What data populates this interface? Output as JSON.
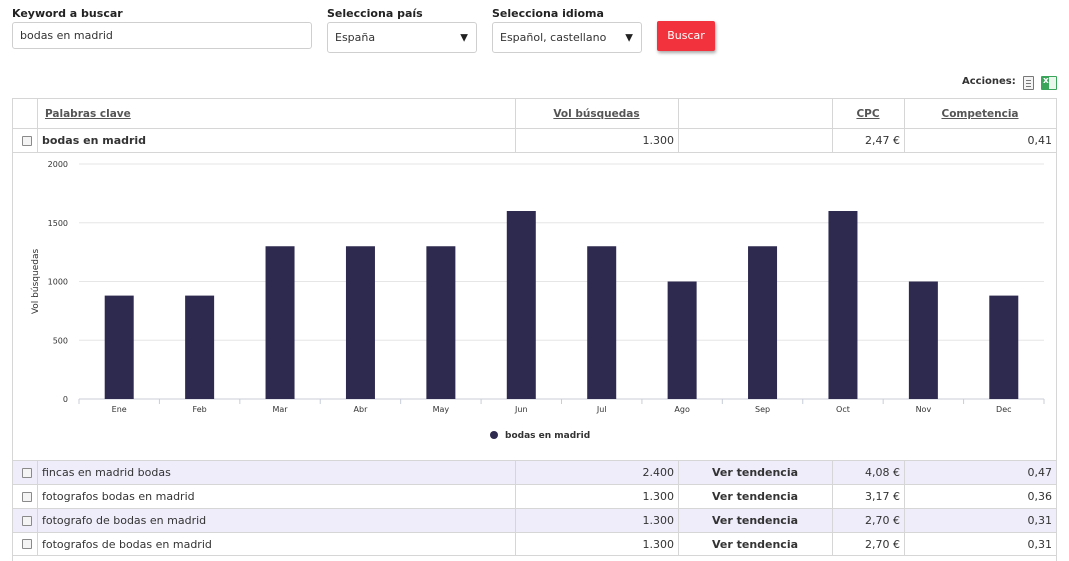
{
  "form": {
    "keyword_label": "Keyword a buscar",
    "keyword_value": "bodas en madrid",
    "country_label": "Selecciona país",
    "country_value": "España",
    "language_label": "Selecciona idioma",
    "language_value": "Español, castellano",
    "search_button": "Buscar"
  },
  "actions": {
    "label": "Acciones:",
    "icons": [
      "document-icon",
      "excel-icon"
    ]
  },
  "table": {
    "headers": {
      "keyword": "Palabras clave",
      "volume": "Vol búsquedas",
      "trend": "",
      "cpc": "CPC",
      "competition": "Competencia"
    },
    "expanded_row": {
      "keyword": "bodas en madrid",
      "volume": "1.300",
      "trend": "",
      "cpc": "2,47 €",
      "competition": "0,41"
    },
    "rows": [
      {
        "keyword": "fincas en madrid bodas",
        "volume": "2.400",
        "trend": "Ver tendencia",
        "cpc": "4,08 €",
        "competition": "0,47"
      },
      {
        "keyword": "fotografos bodas en madrid",
        "volume": "1.300",
        "trend": "Ver tendencia",
        "cpc": "3,17 €",
        "competition": "0,36"
      },
      {
        "keyword": "fotografo de bodas en madrid",
        "volume": "1.300",
        "trend": "Ver tendencia",
        "cpc": "2,70 €",
        "competition": "0,31"
      },
      {
        "keyword": "fotografos de bodas en madrid",
        "volume": "1.300",
        "trend": "Ver tendencia",
        "cpc": "2,70 €",
        "competition": "0,31"
      }
    ],
    "row_colors": {
      "highlight": "#efedfa",
      "plain": "#ffffff"
    }
  },
  "chart_data": {
    "type": "bar",
    "categories": [
      "Ene",
      "Feb",
      "Mar",
      "Abr",
      "May",
      "Jun",
      "Jul",
      "Ago",
      "Sep",
      "Oct",
      "Nov",
      "Dec"
    ],
    "series": [
      {
        "name": "bodas en madrid",
        "values": [
          880,
          880,
          1300,
          1300,
          1300,
          1600,
          1300,
          1000,
          1300,
          1600,
          1000,
          880
        ],
        "color": "#2e2a4f"
      }
    ],
    "ylabel": "Vol búsquedas",
    "xlabel": "",
    "ylim": [
      0,
      2000
    ],
    "yticks": [
      0,
      500,
      1000,
      1500,
      2000
    ],
    "grid": true,
    "legend": "bottom-center"
  }
}
